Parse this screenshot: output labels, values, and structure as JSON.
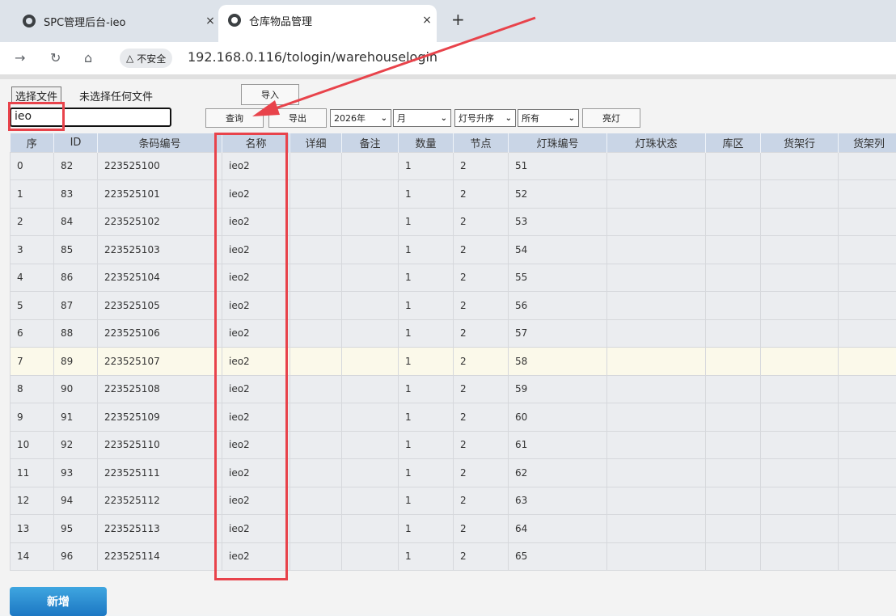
{
  "browser": {
    "tabs": [
      {
        "title": "SPC管理后台-ieo",
        "close": "×"
      },
      {
        "title": "仓库物品管理",
        "close": "×"
      }
    ],
    "new_tab": "+",
    "security_label": "不安全",
    "url": "192.168.0.116/tologin/warehouselogin"
  },
  "toolbar": {
    "choose_file": "选择文件",
    "no_file": "未选择任何文件",
    "import": "导入",
    "search_value": "ieo",
    "query": "查询",
    "export": "导出",
    "year": "2026年",
    "month": "月",
    "sort": "灯号升序",
    "filter": "所有",
    "light": "亮灯"
  },
  "table": {
    "headers": [
      "序",
      "ID",
      "条码编号",
      "名称",
      "详细",
      "备注",
      "数量",
      "节点",
      "灯珠编号",
      "灯珠状态",
      "库区",
      "货架行",
      "货架列"
    ],
    "rows": [
      [
        "0",
        "82",
        "223525100",
        "ieo2",
        "",
        "",
        "1",
        "2",
        "51",
        "",
        "",
        "",
        ""
      ],
      [
        "1",
        "83",
        "223525101",
        "ieo2",
        "",
        "",
        "1",
        "2",
        "52",
        "",
        "",
        "",
        ""
      ],
      [
        "2",
        "84",
        "223525102",
        "ieo2",
        "",
        "",
        "1",
        "2",
        "53",
        "",
        "",
        "",
        ""
      ],
      [
        "3",
        "85",
        "223525103",
        "ieo2",
        "",
        "",
        "1",
        "2",
        "54",
        "",
        "",
        "",
        ""
      ],
      [
        "4",
        "86",
        "223525104",
        "ieo2",
        "",
        "",
        "1",
        "2",
        "55",
        "",
        "",
        "",
        ""
      ],
      [
        "5",
        "87",
        "223525105",
        "ieo2",
        "",
        "",
        "1",
        "2",
        "56",
        "",
        "",
        "",
        ""
      ],
      [
        "6",
        "88",
        "223525106",
        "ieo2",
        "",
        "",
        "1",
        "2",
        "57",
        "",
        "",
        "",
        ""
      ],
      [
        "7",
        "89",
        "223525107",
        "ieo2",
        "",
        "",
        "1",
        "2",
        "58",
        "",
        "",
        "",
        ""
      ],
      [
        "8",
        "90",
        "223525108",
        "ieo2",
        "",
        "",
        "1",
        "2",
        "59",
        "",
        "",
        "",
        ""
      ],
      [
        "9",
        "91",
        "223525109",
        "ieo2",
        "",
        "",
        "1",
        "2",
        "60",
        "",
        "",
        "",
        ""
      ],
      [
        "10",
        "92",
        "223525110",
        "ieo2",
        "",
        "",
        "1",
        "2",
        "61",
        "",
        "",
        "",
        ""
      ],
      [
        "11",
        "93",
        "223525111",
        "ieo2",
        "",
        "",
        "1",
        "2",
        "62",
        "",
        "",
        "",
        ""
      ],
      [
        "12",
        "94",
        "223525112",
        "ieo2",
        "",
        "",
        "1",
        "2",
        "63",
        "",
        "",
        "",
        ""
      ],
      [
        "13",
        "95",
        "223525113",
        "ieo2",
        "",
        "",
        "1",
        "2",
        "64",
        "",
        "",
        "",
        ""
      ],
      [
        "14",
        "96",
        "223525114",
        "ieo2",
        "",
        "",
        "1",
        "2",
        "65",
        "",
        "",
        "",
        ""
      ]
    ],
    "highlighted_row": 7
  },
  "add_button": "新增",
  "colors": {
    "annotation": "#e8434b",
    "header_bg": "#c9d5e6",
    "add_button": "#1c77c3"
  }
}
